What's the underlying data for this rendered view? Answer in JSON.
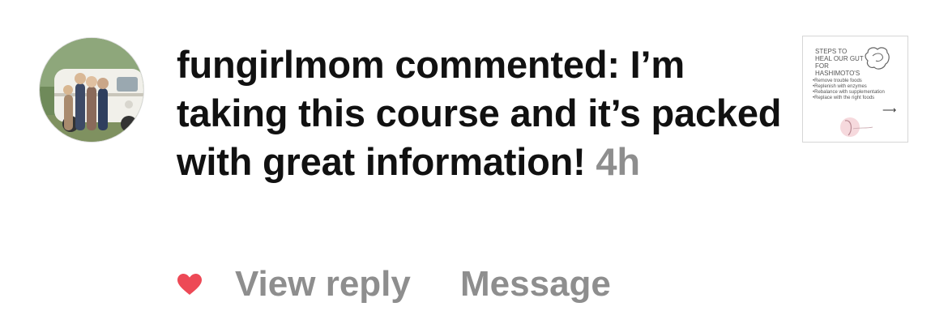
{
  "notification": {
    "username": "fungirlmom",
    "action": "commented:",
    "comment": "I’m taking this course and it’s packed with great information!",
    "time": "4h"
  },
  "thumbnail": {
    "title_lines": [
      "STEPS TO",
      "HEAL OUR GUT",
      "FOR HASHIMOTO'S"
    ],
    "bullets": [
      "Remove trouble foods",
      "Replenish with enzymes",
      "Rebalance with supplementation",
      "Replace with the right foods"
    ],
    "arrow_icon": "arrow-right-icon"
  },
  "actions": {
    "like_icon": "heart-icon",
    "like_color": "#ed4956",
    "view_reply": "View reply",
    "message": "Message"
  },
  "colors": {
    "text": "#111111",
    "secondary": "#8e8e8e"
  }
}
